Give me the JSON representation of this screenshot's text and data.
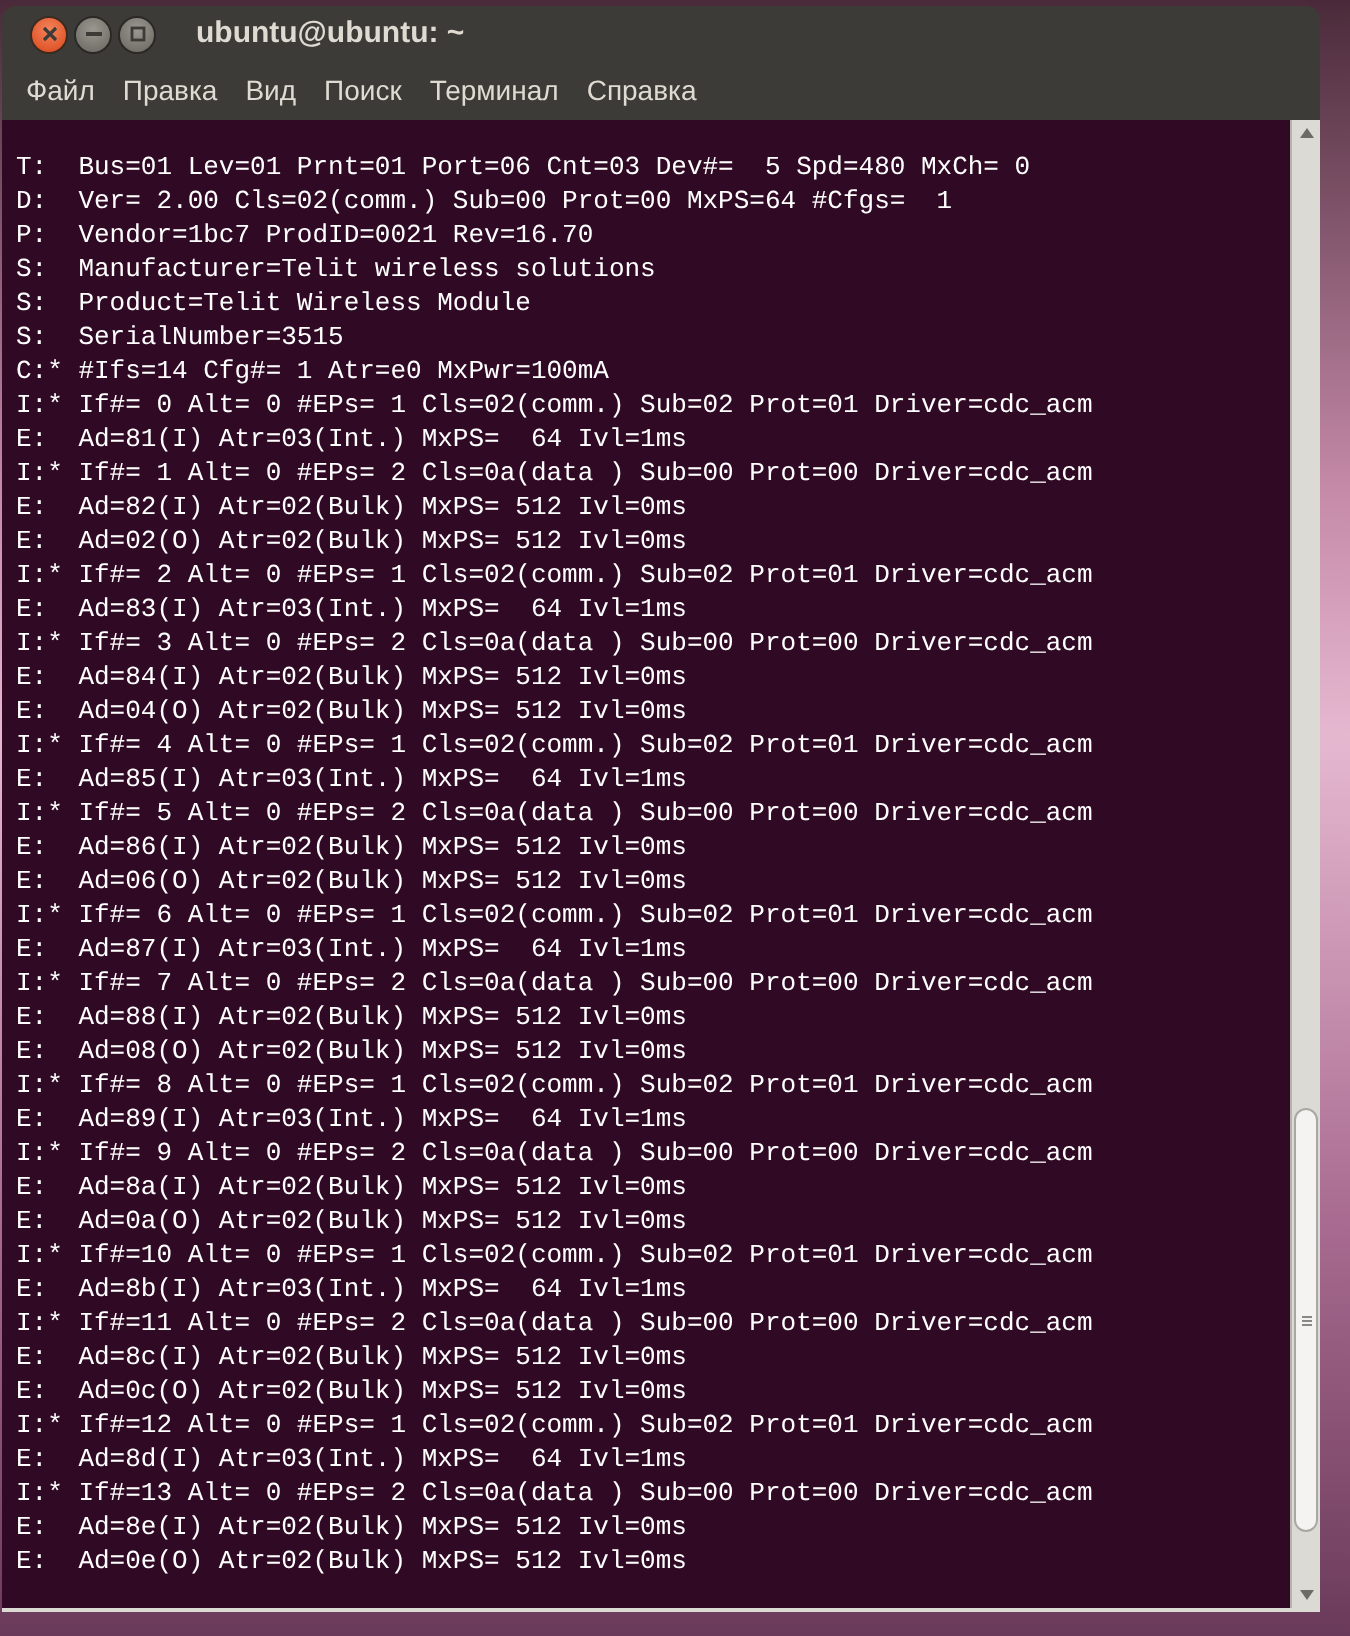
{
  "window": {
    "title": "ubuntu@ubuntu: ~"
  },
  "menu": [
    "Файл",
    "Правка",
    "Вид",
    "Поиск",
    "Терминал",
    "Справка"
  ],
  "terminal_lines": [
    "T:  Bus=01 Lev=01 Prnt=01 Port=06 Cnt=03 Dev#=  5 Spd=480 MxCh= 0",
    "D:  Ver= 2.00 Cls=02(comm.) Sub=00 Prot=00 MxPS=64 #Cfgs=  1",
    "P:  Vendor=1bc7 ProdID=0021 Rev=16.70",
    "S:  Manufacturer=Telit wireless solutions",
    "S:  Product=Telit Wireless Module",
    "S:  SerialNumber=3515",
    "C:* #Ifs=14 Cfg#= 1 Atr=e0 MxPwr=100mA",
    "I:* If#= 0 Alt= 0 #EPs= 1 Cls=02(comm.) Sub=02 Prot=01 Driver=cdc_acm",
    "E:  Ad=81(I) Atr=03(Int.) MxPS=  64 Ivl=1ms",
    "I:* If#= 1 Alt= 0 #EPs= 2 Cls=0a(data ) Sub=00 Prot=00 Driver=cdc_acm",
    "E:  Ad=82(I) Atr=02(Bulk) MxPS= 512 Ivl=0ms",
    "E:  Ad=02(O) Atr=02(Bulk) MxPS= 512 Ivl=0ms",
    "I:* If#= 2 Alt= 0 #EPs= 1 Cls=02(comm.) Sub=02 Prot=01 Driver=cdc_acm",
    "E:  Ad=83(I) Atr=03(Int.) MxPS=  64 Ivl=1ms",
    "I:* If#= 3 Alt= 0 #EPs= 2 Cls=0a(data ) Sub=00 Prot=00 Driver=cdc_acm",
    "E:  Ad=84(I) Atr=02(Bulk) MxPS= 512 Ivl=0ms",
    "E:  Ad=04(O) Atr=02(Bulk) MxPS= 512 Ivl=0ms",
    "I:* If#= 4 Alt= 0 #EPs= 1 Cls=02(comm.) Sub=02 Prot=01 Driver=cdc_acm",
    "E:  Ad=85(I) Atr=03(Int.) MxPS=  64 Ivl=1ms",
    "I:* If#= 5 Alt= 0 #EPs= 2 Cls=0a(data ) Sub=00 Prot=00 Driver=cdc_acm",
    "E:  Ad=86(I) Atr=02(Bulk) MxPS= 512 Ivl=0ms",
    "E:  Ad=06(O) Atr=02(Bulk) MxPS= 512 Ivl=0ms",
    "I:* If#= 6 Alt= 0 #EPs= 1 Cls=02(comm.) Sub=02 Prot=01 Driver=cdc_acm",
    "E:  Ad=87(I) Atr=03(Int.) MxPS=  64 Ivl=1ms",
    "I:* If#= 7 Alt= 0 #EPs= 2 Cls=0a(data ) Sub=00 Prot=00 Driver=cdc_acm",
    "E:  Ad=88(I) Atr=02(Bulk) MxPS= 512 Ivl=0ms",
    "E:  Ad=08(O) Atr=02(Bulk) MxPS= 512 Ivl=0ms",
    "I:* If#= 8 Alt= 0 #EPs= 1 Cls=02(comm.) Sub=02 Prot=01 Driver=cdc_acm",
    "E:  Ad=89(I) Atr=03(Int.) MxPS=  64 Ivl=1ms",
    "I:* If#= 9 Alt= 0 #EPs= 2 Cls=0a(data ) Sub=00 Prot=00 Driver=cdc_acm",
    "E:  Ad=8a(I) Atr=02(Bulk) MxPS= 512 Ivl=0ms",
    "E:  Ad=0a(O) Atr=02(Bulk) MxPS= 512 Ivl=0ms",
    "I:* If#=10 Alt= 0 #EPs= 1 Cls=02(comm.) Sub=02 Prot=01 Driver=cdc_acm",
    "E:  Ad=8b(I) Atr=03(Int.) MxPS=  64 Ivl=1ms",
    "I:* If#=11 Alt= 0 #EPs= 2 Cls=0a(data ) Sub=00 Prot=00 Driver=cdc_acm",
    "E:  Ad=8c(I) Atr=02(Bulk) MxPS= 512 Ivl=0ms",
    "E:  Ad=0c(O) Atr=02(Bulk) MxPS= 512 Ivl=0ms",
    "I:* If#=12 Alt= 0 #EPs= 1 Cls=02(comm.) Sub=02 Prot=01 Driver=cdc_acm",
    "E:  Ad=8d(I) Atr=03(Int.) MxPS=  64 Ivl=1ms",
    "I:* If#=13 Alt= 0 #EPs= 2 Cls=0a(data ) Sub=00 Prot=00 Driver=cdc_acm",
    "E:  Ad=8e(I) Atr=02(Bulk) MxPS= 512 Ivl=0ms",
    "E:  Ad=0e(O) Atr=02(Bulk) MxPS= 512 Ivl=0ms"
  ]
}
